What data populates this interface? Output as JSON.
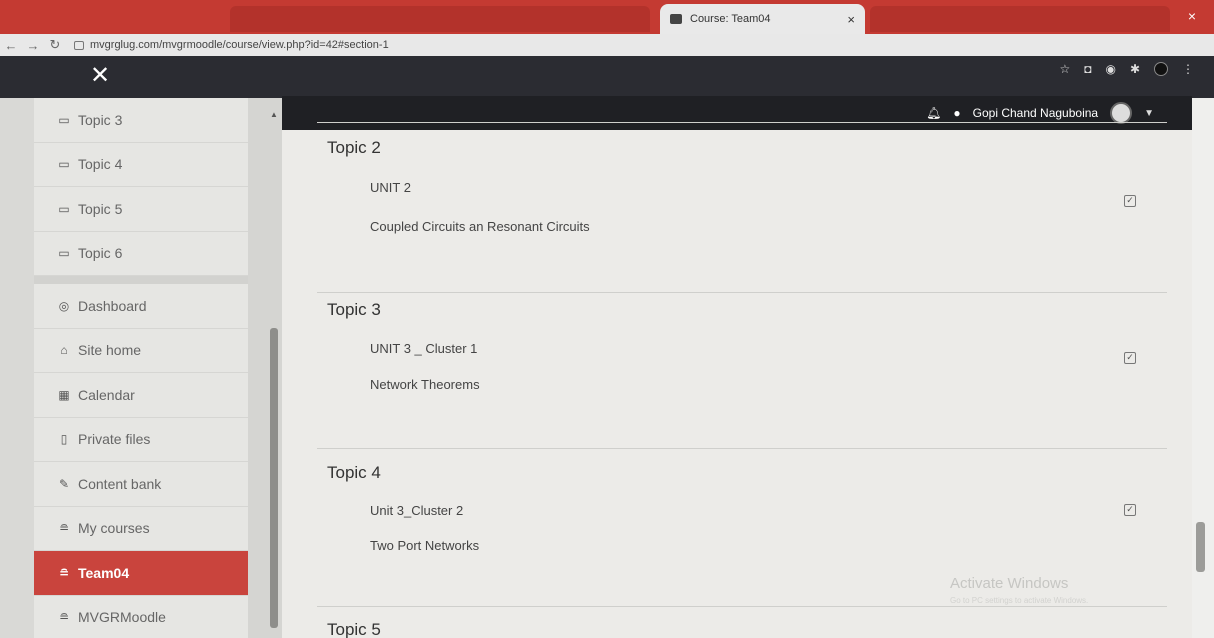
{
  "browser": {
    "active_tab_title": "Course: Team04",
    "tab_close": "×",
    "url": "mvgrglug.com/mvgrmoodle/course/view.php?id=42#section-1",
    "window_close": "×"
  },
  "navbar": {
    "drawer_close": "✕",
    "user_name": "Gopi Chand Naguboina"
  },
  "drawer": {
    "sections": [
      {
        "label": "Topic 3",
        "icon": "folder-icon"
      },
      {
        "label": "Topic 4",
        "icon": "folder-icon"
      },
      {
        "label": "Topic 5",
        "icon": "folder-icon"
      },
      {
        "label": "Topic 6",
        "icon": "folder-icon"
      }
    ],
    "nav": [
      {
        "label": "Dashboard",
        "icon": "dashboard-icon"
      },
      {
        "label": "Site home",
        "icon": "home-icon"
      },
      {
        "label": "Calendar",
        "icon": "calendar-icon"
      },
      {
        "label": "Private files",
        "icon": "file-icon"
      },
      {
        "label": "Content bank",
        "icon": "pencil-icon"
      },
      {
        "label": "My courses",
        "icon": "graduation-cap-icon"
      },
      {
        "label": "Team04",
        "icon": "graduation-cap-icon",
        "active": true
      },
      {
        "label": "MVGRMoodle",
        "icon": "graduation-cap-icon"
      }
    ]
  },
  "main": {
    "topics": [
      {
        "title": "Topic 2",
        "activities": [
          "UNIT 2",
          "Coupled Circuits an Resonant Circuits"
        ]
      },
      {
        "title": "Topic 3",
        "activities": [
          "UNIT 3 _ Cluster 1",
          "Network Theorems"
        ]
      },
      {
        "title": "Topic 4",
        "activities": [
          "Unit 3_Cluster 2",
          "Two Port Networks"
        ]
      },
      {
        "title": "Topic 5",
        "activities": []
      }
    ]
  },
  "watermark": {
    "title": "Activate Windows",
    "subtitle": "Go to PC settings to activate Windows."
  },
  "colors": {
    "brand_red": "#c9443d",
    "navbar_dark": "#2b2c32"
  }
}
